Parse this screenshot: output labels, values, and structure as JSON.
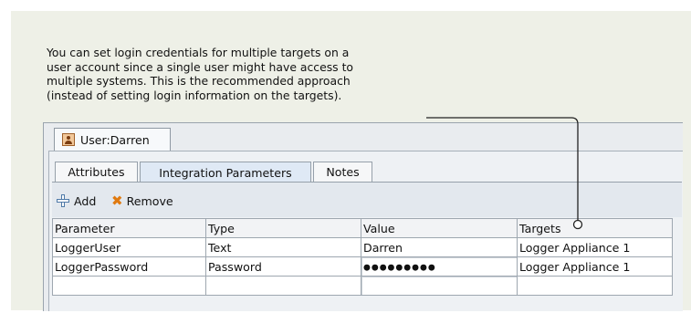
{
  "callout": {
    "lines": [
      "You can set login credentials for multiple targets on a",
      "user account since a single user might have access to",
      "multiple systems. This is the recommended approach",
      "(instead of setting login information on the targets)."
    ]
  },
  "document_tab": {
    "label": "User:Darren",
    "icon": "user-icon"
  },
  "tabs": [
    {
      "label": "Attributes",
      "active": false
    },
    {
      "label": "Integration Parameters",
      "active": true
    },
    {
      "label": "Notes",
      "active": false
    }
  ],
  "toolbar": {
    "add_label": "Add",
    "add_icon": "add-icon",
    "remove_label": "Remove",
    "remove_icon": "remove-icon"
  },
  "table": {
    "columns": [
      "Parameter",
      "Type",
      "Value",
      "Targets"
    ],
    "rows": [
      [
        "LoggerUser",
        "Text",
        "Darren",
        "Logger Appliance 1"
      ],
      [
        "LoggerPassword",
        "Password",
        "●●●●●●●●●",
        "Logger Appliance 1"
      ],
      [
        "",
        "",
        "",
        ""
      ]
    ]
  },
  "colors": {
    "panel_bg": "#eef0e7",
    "active_tab_bg": "#dfe9f5",
    "remove_icon": "#e07a10",
    "add_icon": "#4f7aa8"
  }
}
